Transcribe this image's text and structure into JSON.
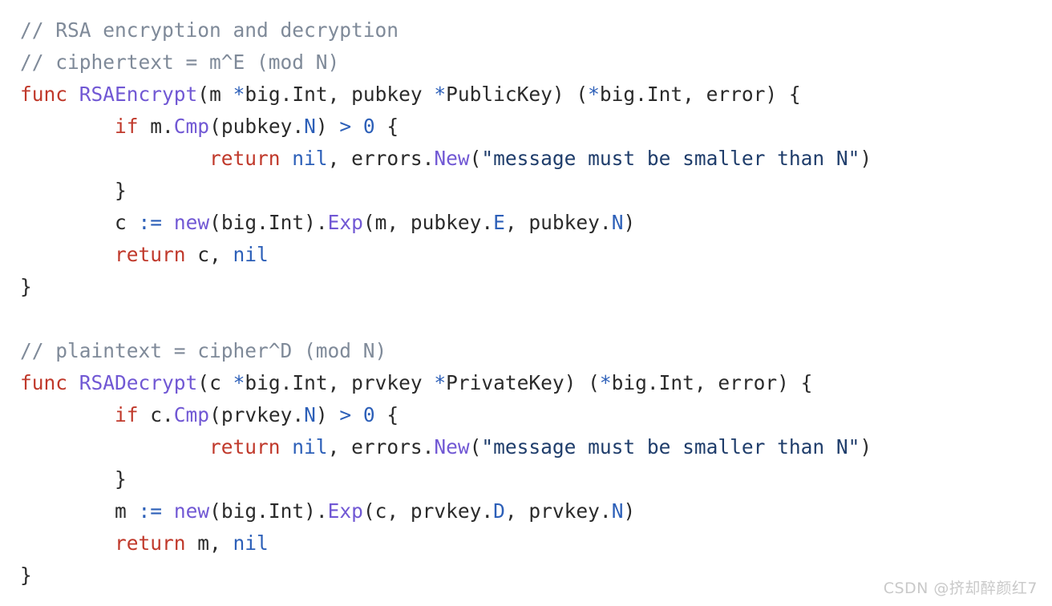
{
  "editor": {
    "language": "Go",
    "background_color": "#ffffff",
    "font_size_px": 24.5,
    "line_height_px": 40,
    "indent_unit_spaces": 8,
    "theme_colors": {
      "comment": "#7f8a99",
      "keyword": "#c0392b",
      "function_name": "#7158d4",
      "operator": "#2c5fb8",
      "constant": "#2c5fb8",
      "number": "#2c5fb8",
      "field": "#2c5fb8",
      "string": "#1f3d6b",
      "plain_text": "#2b2b2b"
    },
    "lines": [
      {
        "n": 1,
        "indent": 0,
        "text": "// RSA encryption and decryption",
        "tokens": [
          {
            "kind": "comment",
            "text": "// RSA encryption and decryption"
          }
        ]
      },
      {
        "n": 2,
        "indent": 0,
        "text": "// ciphertext = m^E (mod N)",
        "tokens": [
          {
            "kind": "comment",
            "text": "// ciphertext = m^E (mod N)"
          }
        ]
      },
      {
        "n": 3,
        "indent": 0,
        "text": "func RSAEncrypt(m *big.Int, pubkey *PublicKey) (*big.Int, error) {",
        "tokens": [
          {
            "kind": "keyword",
            "text": "func"
          },
          {
            "kind": "plain",
            "text": " "
          },
          {
            "kind": "func",
            "text": "RSAEncrypt"
          },
          {
            "kind": "punct",
            "text": "("
          },
          {
            "kind": "plain",
            "text": "m "
          },
          {
            "kind": "op",
            "text": "*"
          },
          {
            "kind": "plain",
            "text": "big.Int, pubkey "
          },
          {
            "kind": "op",
            "text": "*"
          },
          {
            "kind": "plain",
            "text": "PublicKey) ("
          },
          {
            "kind": "op",
            "text": "*"
          },
          {
            "kind": "plain",
            "text": "big.Int, error) {"
          }
        ]
      },
      {
        "n": 4,
        "indent": 1,
        "text": "if m.Cmp(pubkey.N) > 0 {",
        "tokens": [
          {
            "kind": "keyword",
            "text": "if"
          },
          {
            "kind": "plain",
            "text": " m."
          },
          {
            "kind": "func",
            "text": "Cmp"
          },
          {
            "kind": "punct",
            "text": "("
          },
          {
            "kind": "plain",
            "text": "pubkey."
          },
          {
            "kind": "field",
            "text": "N"
          },
          {
            "kind": "punct",
            "text": ") "
          },
          {
            "kind": "op",
            "text": ">"
          },
          {
            "kind": "plain",
            "text": " "
          },
          {
            "kind": "number",
            "text": "0"
          },
          {
            "kind": "plain",
            "text": " {"
          }
        ]
      },
      {
        "n": 5,
        "indent": 2,
        "text": "return nil, errors.New(\"message must be smaller than N\")",
        "tokens": [
          {
            "kind": "keyword",
            "text": "return"
          },
          {
            "kind": "plain",
            "text": " "
          },
          {
            "kind": "const",
            "text": "nil"
          },
          {
            "kind": "plain",
            "text": ", errors."
          },
          {
            "kind": "func",
            "text": "New"
          },
          {
            "kind": "punct",
            "text": "("
          },
          {
            "kind": "string",
            "text": "\"message must be smaller than N\""
          },
          {
            "kind": "punct",
            "text": ")"
          }
        ]
      },
      {
        "n": 6,
        "indent": 1,
        "text": "}",
        "tokens": [
          {
            "kind": "punct",
            "text": "}"
          }
        ]
      },
      {
        "n": 7,
        "indent": 1,
        "text": "c := new(big.Int).Exp(m, pubkey.E, pubkey.N)",
        "tokens": [
          {
            "kind": "plain",
            "text": "c "
          },
          {
            "kind": "op",
            "text": ":="
          },
          {
            "kind": "plain",
            "text": " "
          },
          {
            "kind": "func",
            "text": "new"
          },
          {
            "kind": "punct",
            "text": "("
          },
          {
            "kind": "plain",
            "text": "big.Int)."
          },
          {
            "kind": "func",
            "text": "Exp"
          },
          {
            "kind": "punct",
            "text": "("
          },
          {
            "kind": "plain",
            "text": "m, pubkey."
          },
          {
            "kind": "field",
            "text": "E"
          },
          {
            "kind": "plain",
            "text": ", pubkey."
          },
          {
            "kind": "field",
            "text": "N"
          },
          {
            "kind": "punct",
            "text": ")"
          }
        ]
      },
      {
        "n": 8,
        "indent": 1,
        "text": "return c, nil",
        "tokens": [
          {
            "kind": "keyword",
            "text": "return"
          },
          {
            "kind": "plain",
            "text": " c, "
          },
          {
            "kind": "const",
            "text": "nil"
          }
        ]
      },
      {
        "n": 9,
        "indent": 0,
        "text": "}",
        "tokens": [
          {
            "kind": "punct",
            "text": "}"
          }
        ]
      },
      {
        "n": 10,
        "indent": 0,
        "text": "",
        "tokens": []
      },
      {
        "n": 11,
        "indent": 0,
        "text": "// plaintext = cipher^D (mod N)",
        "tokens": [
          {
            "kind": "comment",
            "text": "// plaintext = cipher^D (mod N)"
          }
        ]
      },
      {
        "n": 12,
        "indent": 0,
        "text": "func RSADecrypt(c *big.Int, prvkey *PrivateKey) (*big.Int, error) {",
        "tokens": [
          {
            "kind": "keyword",
            "text": "func"
          },
          {
            "kind": "plain",
            "text": " "
          },
          {
            "kind": "func",
            "text": "RSADecrypt"
          },
          {
            "kind": "punct",
            "text": "("
          },
          {
            "kind": "plain",
            "text": "c "
          },
          {
            "kind": "op",
            "text": "*"
          },
          {
            "kind": "plain",
            "text": "big.Int, prvkey "
          },
          {
            "kind": "op",
            "text": "*"
          },
          {
            "kind": "plain",
            "text": "PrivateKey) ("
          },
          {
            "kind": "op",
            "text": "*"
          },
          {
            "kind": "plain",
            "text": "big.Int, error) {"
          }
        ]
      },
      {
        "n": 13,
        "indent": 1,
        "text": "if c.Cmp(prvkey.N) > 0 {",
        "tokens": [
          {
            "kind": "keyword",
            "text": "if"
          },
          {
            "kind": "plain",
            "text": " c."
          },
          {
            "kind": "func",
            "text": "Cmp"
          },
          {
            "kind": "punct",
            "text": "("
          },
          {
            "kind": "plain",
            "text": "prvkey."
          },
          {
            "kind": "field",
            "text": "N"
          },
          {
            "kind": "punct",
            "text": ") "
          },
          {
            "kind": "op",
            "text": ">"
          },
          {
            "kind": "plain",
            "text": " "
          },
          {
            "kind": "number",
            "text": "0"
          },
          {
            "kind": "plain",
            "text": " {"
          }
        ]
      },
      {
        "n": 14,
        "indent": 2,
        "text": "return nil, errors.New(\"message must be smaller than N\")",
        "tokens": [
          {
            "kind": "keyword",
            "text": "return"
          },
          {
            "kind": "plain",
            "text": " "
          },
          {
            "kind": "const",
            "text": "nil"
          },
          {
            "kind": "plain",
            "text": ", errors."
          },
          {
            "kind": "func",
            "text": "New"
          },
          {
            "kind": "punct",
            "text": "("
          },
          {
            "kind": "string",
            "text": "\"message must be smaller than N\""
          },
          {
            "kind": "punct",
            "text": ")"
          }
        ]
      },
      {
        "n": 15,
        "indent": 1,
        "text": "}",
        "tokens": [
          {
            "kind": "punct",
            "text": "}"
          }
        ]
      },
      {
        "n": 16,
        "indent": 1,
        "text": "m := new(big.Int).Exp(c, prvkey.D, prvkey.N)",
        "tokens": [
          {
            "kind": "plain",
            "text": "m "
          },
          {
            "kind": "op",
            "text": ":="
          },
          {
            "kind": "plain",
            "text": " "
          },
          {
            "kind": "func",
            "text": "new"
          },
          {
            "kind": "punct",
            "text": "("
          },
          {
            "kind": "plain",
            "text": "big.Int)."
          },
          {
            "kind": "func",
            "text": "Exp"
          },
          {
            "kind": "punct",
            "text": "("
          },
          {
            "kind": "plain",
            "text": "c, prvkey."
          },
          {
            "kind": "field",
            "text": "D"
          },
          {
            "kind": "plain",
            "text": ", prvkey."
          },
          {
            "kind": "field",
            "text": "N"
          },
          {
            "kind": "punct",
            "text": ")"
          }
        ]
      },
      {
        "n": 17,
        "indent": 1,
        "text": "return m, nil",
        "tokens": [
          {
            "kind": "keyword",
            "text": "return"
          },
          {
            "kind": "plain",
            "text": " m, "
          },
          {
            "kind": "const",
            "text": "nil"
          }
        ]
      },
      {
        "n": 18,
        "indent": 0,
        "text": "}",
        "tokens": [
          {
            "kind": "punct",
            "text": "}"
          }
        ]
      }
    ]
  },
  "watermark": {
    "text": "CSDN @挤却醉颜红7",
    "color": "#c9c9c9"
  }
}
